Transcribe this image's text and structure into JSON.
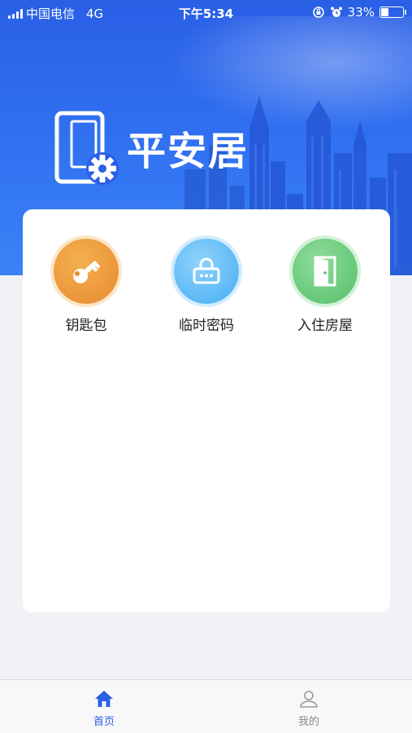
{
  "status_bar": {
    "carrier": "中国电信",
    "network": "4G",
    "time": "下午5:34",
    "battery": "33%"
  },
  "header": {
    "app_title": "平安居"
  },
  "features": [
    {
      "label": "钥匙包",
      "icon": "key-icon",
      "color": "#e88a33"
    },
    {
      "label": "临时密码",
      "icon": "lock-icon",
      "color": "#47aef2"
    },
    {
      "label": "入住房屋",
      "icon": "door-icon",
      "color": "#54c06a"
    }
  ],
  "tabbar": {
    "home_label": "首页",
    "mine_label": "我的",
    "active_color": "#2a5fe6",
    "inactive_color": "#8a8a8a"
  }
}
